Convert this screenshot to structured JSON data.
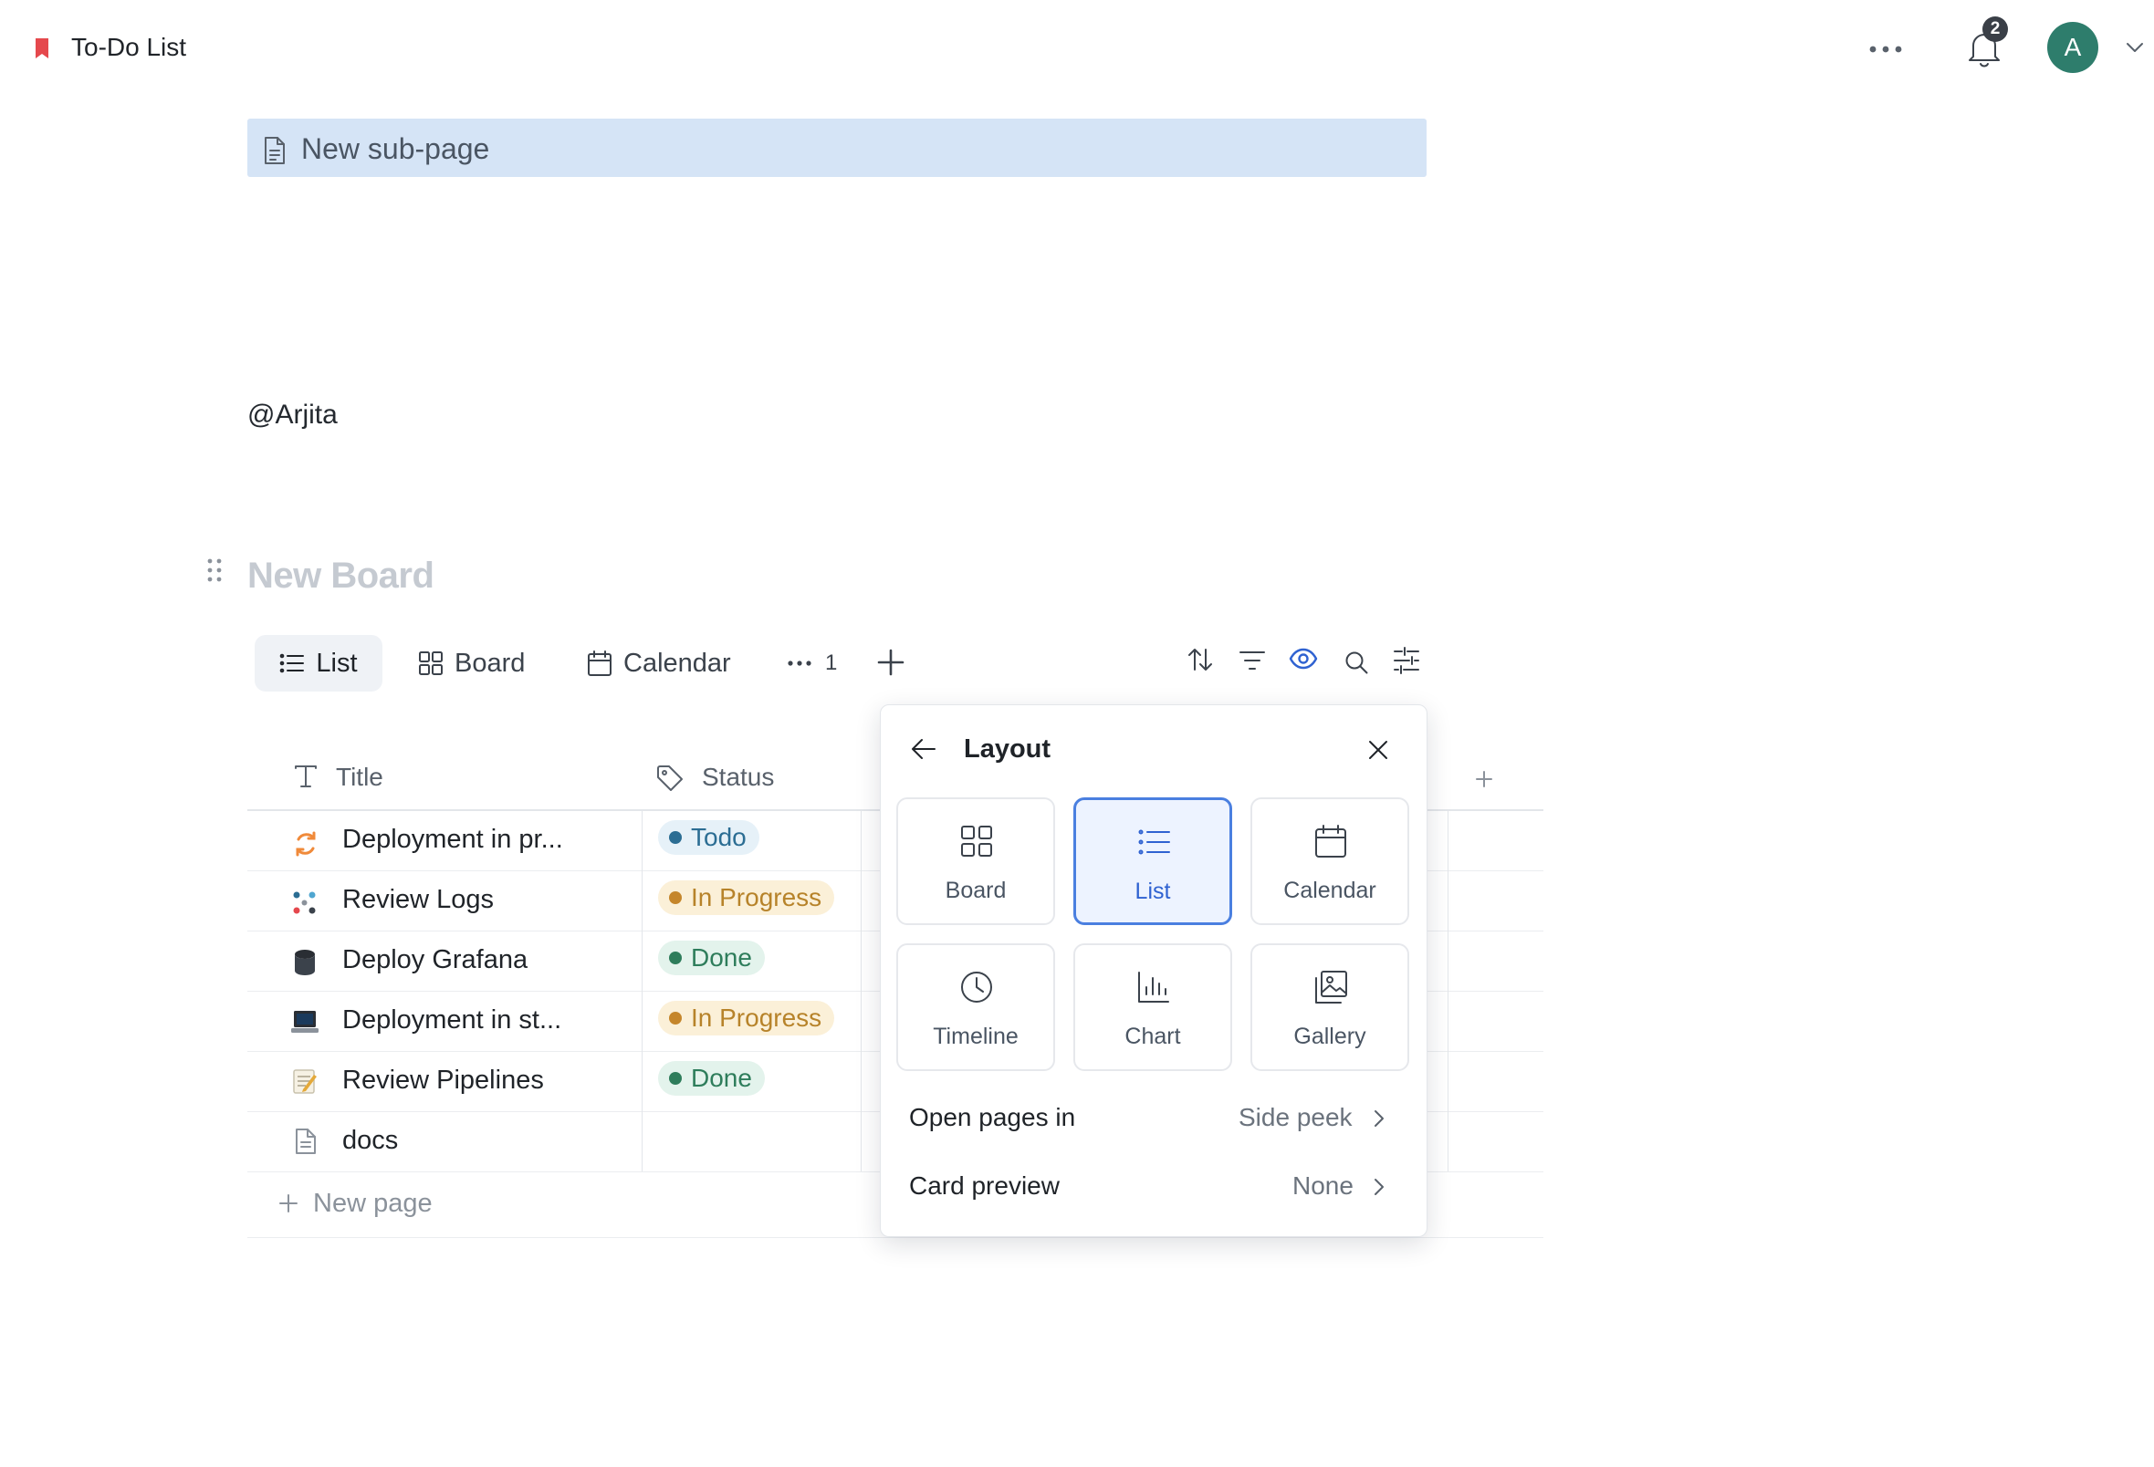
{
  "header": {
    "title": "To-Do List",
    "notification_count": "2",
    "avatar_initial": "A"
  },
  "content": {
    "subpage_label": "New sub-page",
    "mention": "@Arjita",
    "board_title": "New Board"
  },
  "views": {
    "tabs": [
      {
        "label": "List",
        "active": true
      },
      {
        "label": "Board"
      },
      {
        "label": "Calendar"
      }
    ],
    "more_count": "1"
  },
  "table": {
    "columns": [
      "Title",
      "Status"
    ],
    "rows": [
      {
        "title": "Deployment in pr...",
        "status": "Todo"
      },
      {
        "title": "Review Logs",
        "status": "In Progress"
      },
      {
        "title": "Deploy Grafana",
        "status": "Done"
      },
      {
        "title": "Deployment in st...",
        "status": "In Progress"
      },
      {
        "title": "Review Pipelines",
        "status": "Done"
      },
      {
        "title": "docs",
        "status": ""
      }
    ],
    "new_page_label": "New page"
  },
  "layout_popover": {
    "title": "Layout",
    "options": [
      {
        "label": "Board",
        "icon": "board-icon"
      },
      {
        "label": "List",
        "icon": "list-icon",
        "selected": true
      },
      {
        "label": "Calendar",
        "icon": "calendar-icon"
      },
      {
        "label": "Timeline",
        "icon": "clock-icon"
      },
      {
        "label": "Chart",
        "icon": "chart-icon"
      },
      {
        "label": "Gallery",
        "icon": "gallery-icon"
      }
    ],
    "open_pages_in": {
      "label": "Open pages in",
      "value": "Side peek"
    },
    "card_preview": {
      "label": "Card preview",
      "value": "None"
    }
  },
  "colors": {
    "accent": "#4a7fe0",
    "todo_bg": "#e6f1f8",
    "todo_dot": "#2b6d93",
    "todo_text": "#2b6d93",
    "progress_bg": "#fbf0d8",
    "progress_dot": "#c5862b",
    "progress_text": "#b7832a",
    "done_bg": "#e3f3ec",
    "done_dot": "#2e7d5b",
    "done_text": "#2e7d5b"
  }
}
